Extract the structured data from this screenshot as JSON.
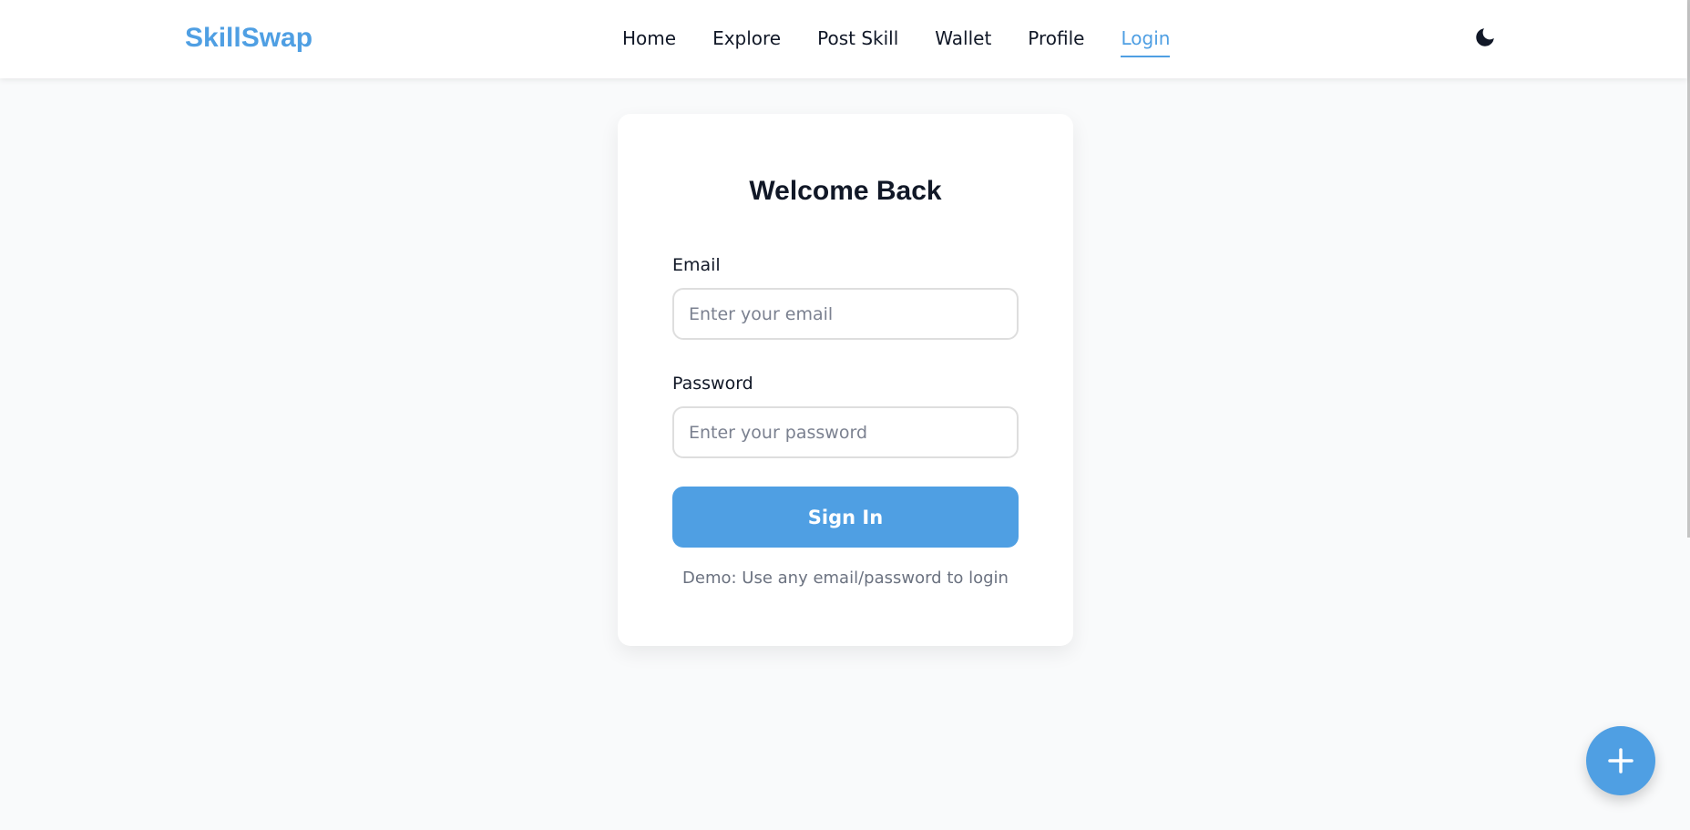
{
  "app": {
    "brand": "SkillSwap",
    "accent_color": "#4f9fe3"
  },
  "nav": {
    "items": [
      {
        "label": "Home",
        "active": false
      },
      {
        "label": "Explore",
        "active": false
      },
      {
        "label": "Post Skill",
        "active": false
      },
      {
        "label": "Wallet",
        "active": false
      },
      {
        "label": "Profile",
        "active": false
      },
      {
        "label": "Login",
        "active": true
      }
    ],
    "theme_icon": "moon-icon"
  },
  "login": {
    "title": "Welcome Back",
    "email": {
      "label": "Email",
      "placeholder": "Enter your email",
      "value": ""
    },
    "password": {
      "label": "Password",
      "placeholder": "Enter your password",
      "value": ""
    },
    "submit_label": "Sign In",
    "demo_note": "Demo: Use any email/password to login"
  },
  "fab": {
    "icon": "plus-icon"
  }
}
